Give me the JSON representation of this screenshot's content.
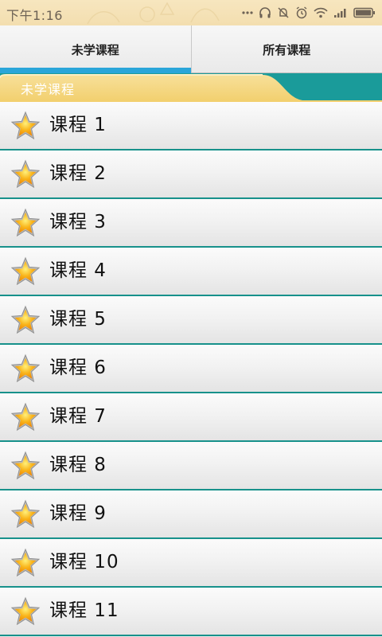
{
  "status_bar": {
    "time": "下午1:16",
    "icons": [
      "more-dots-icon",
      "headphones-icon",
      "bell-off-icon",
      "alarm-icon",
      "wifi-icon",
      "signal-icon",
      "battery-icon"
    ]
  },
  "tabs": [
    {
      "label": "未学课程",
      "active": true
    },
    {
      "label": "所有课程",
      "active": false
    }
  ],
  "section": {
    "title": "未学课程"
  },
  "courses": [
    {
      "label": "课程 1"
    },
    {
      "label": "课程 2"
    },
    {
      "label": "课程 3"
    },
    {
      "label": "课程 4"
    },
    {
      "label": "课程 5"
    },
    {
      "label": "课程 6"
    },
    {
      "label": "课程 7"
    },
    {
      "label": "课程 8"
    },
    {
      "label": "课程 9"
    },
    {
      "label": "课程 10"
    },
    {
      "label": "课程 11"
    }
  ],
  "colors": {
    "status_bar_bg": "#f5e2b5",
    "tab_active_indicator": "#2aa6d9",
    "section_teal": "#1a9b9a",
    "section_tab_yellow": "#f6d98a",
    "row_divider": "#17918b",
    "star_fill": "#f7a70c"
  }
}
